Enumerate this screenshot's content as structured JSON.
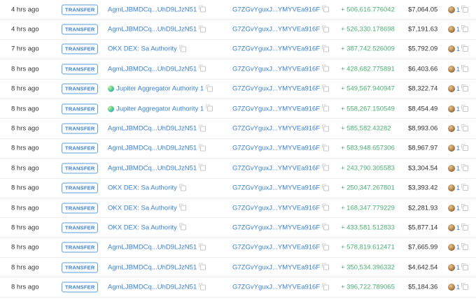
{
  "badge_label": "TRANSFER",
  "colors": {
    "link": "#3b82d6",
    "amount": "#4caf74"
  },
  "rows": [
    {
      "time": "4 hrs ago",
      "from": "AgmLJBMDCq...UhD9LJzN51",
      "from_icon": "",
      "to": "G7ZGvYguxJ...YMYVEa916F",
      "amount": "+ 506,616.776042",
      "value": "$7,064.05",
      "token_count": "1"
    },
    {
      "time": "4 hrs ago",
      "from": "AgmLJBMDCq...UhD9LJzN51",
      "from_icon": "",
      "to": "G7ZGvYguxJ...YMYVEa916F",
      "amount": "+ 526,330.178698",
      "value": "$7,191.63",
      "token_count": "1"
    },
    {
      "time": "7 hrs ago",
      "from": "OKX DEX: Sa Authority",
      "from_icon": "",
      "to": "G7ZGvYguxJ...YMYVEa916F",
      "amount": "+ 387,742.526009",
      "value": "$5,792.09",
      "token_count": "1"
    },
    {
      "time": "8 hrs ago",
      "from": "AgmLJBMDCq...UhD9LJzN51",
      "from_icon": "",
      "to": "G7ZGvYguxJ...YMYVEa916F",
      "amount": "+ 428,682.775891",
      "value": "$6,403.66",
      "token_count": "1"
    },
    {
      "time": "8 hrs ago",
      "from": "Jupiter Aggregator Authority 1",
      "from_icon": "jupiter-icon",
      "to": "G7ZGvYguxJ...YMYVEa916F",
      "amount": "+ 549,567.940947",
      "value": "$8,322.74",
      "token_count": "1"
    },
    {
      "time": "8 hrs ago",
      "from": "Jupiter Aggregator Authority 1",
      "from_icon": "jupiter-icon",
      "to": "G7ZGvYguxJ...YMYVEa916F",
      "amount": "+ 558,267.150549",
      "value": "$8,454.49",
      "token_count": "1"
    },
    {
      "time": "8 hrs ago",
      "from": "AgmLJBMDCq...UhD9LJzN51",
      "from_icon": "",
      "to": "G7ZGvYguxJ...YMYVEa916F",
      "amount": "+ 585,582.43282",
      "value": "$8,993.06",
      "token_count": "1"
    },
    {
      "time": "8 hrs ago",
      "from": "AgmLJBMDCq...UhD9LJzN51",
      "from_icon": "",
      "to": "G7ZGvYguxJ...YMYVEa916F",
      "amount": "+ 583,948.657306",
      "value": "$8,967.97",
      "token_count": "1"
    },
    {
      "time": "8 hrs ago",
      "from": "AgmLJBMDCq...UhD9LJzN51",
      "from_icon": "",
      "to": "G7ZGvYguxJ...YMYVEa916F",
      "amount": "+ 243,790.305583",
      "value": "$3,304.54",
      "token_count": "1"
    },
    {
      "time": "8 hrs ago",
      "from": "OKX DEX: Sa Authority",
      "from_icon": "",
      "to": "G7ZGvYguxJ...YMYVEa916F",
      "amount": "+ 250,347.267801",
      "value": "$3,393.42",
      "token_count": "1"
    },
    {
      "time": "8 hrs ago",
      "from": "OKX DEX: Sa Authority",
      "from_icon": "",
      "to": "G7ZGvYguxJ...YMYVEa916F",
      "amount": "+ 168,347.779229",
      "value": "$2,281.93",
      "token_count": "1"
    },
    {
      "time": "8 hrs ago",
      "from": "OKX DEX: Sa Authority",
      "from_icon": "",
      "to": "G7ZGvYguxJ...YMYVEa916F",
      "amount": "+ 433,581.512833",
      "value": "$5,877.14",
      "token_count": "1"
    },
    {
      "time": "8 hrs ago",
      "from": "AgmLJBMDCq...UhD9LJzN51",
      "from_icon": "",
      "to": "G7ZGvYguxJ...YMYVEa916F",
      "amount": "+ 578,819.612471",
      "value": "$7,665.99",
      "token_count": "1"
    },
    {
      "time": "8 hrs ago",
      "from": "AgmLJBMDCq...UhD9LJzN51",
      "from_icon": "",
      "to": "G7ZGvYguxJ...YMYVEa916F",
      "amount": "+ 350,534.396332",
      "value": "$4,642.54",
      "token_count": "1"
    },
    {
      "time": "8 hrs ago",
      "from": "AgmLJBMDCq...UhD9LJzN51",
      "from_icon": "",
      "to": "G7ZGvYguxJ...YMYVEa916F",
      "amount": "+ 396,722.789065",
      "value": "$5,184.36",
      "token_count": "1"
    }
  ]
}
